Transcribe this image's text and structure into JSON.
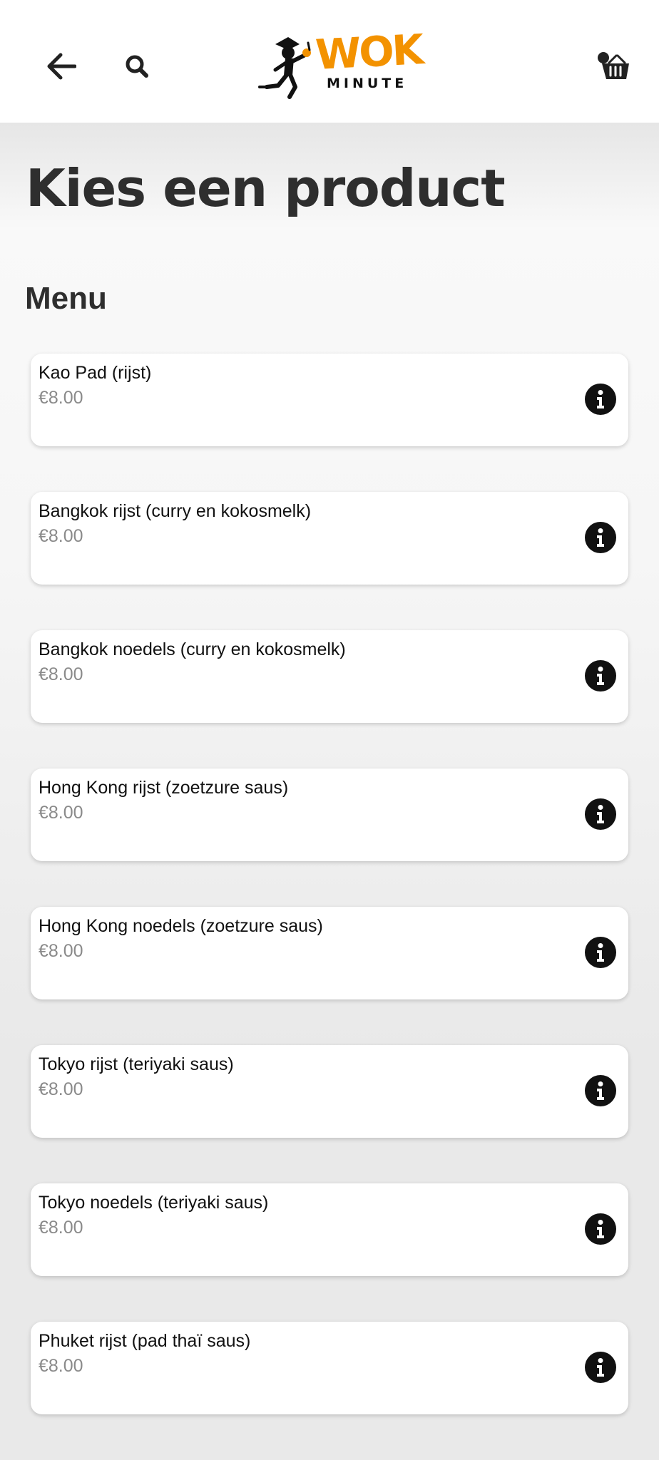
{
  "header": {
    "back_icon": "arrow-left-icon",
    "search_icon": "search-icon",
    "cart_icon": "basket-icon",
    "logo": {
      "line1": "WOK",
      "line2": "MINUTE",
      "brand_color": "#f39200"
    }
  },
  "page": {
    "title": "Kies een product"
  },
  "menu": {
    "section_title": "Menu",
    "items": [
      {
        "name": "Kao Pad (rijst)",
        "price": "€8.00"
      },
      {
        "name": "Bangkok rijst (curry en kokosmelk)",
        "price": "€8.00"
      },
      {
        "name": "Bangkok noedels (curry en kokosmelk)",
        "price": "€8.00"
      },
      {
        "name": "Hong Kong rijst (zoetzure saus)",
        "price": "€8.00"
      },
      {
        "name": "Hong Kong noedels (zoetzure saus)",
        "price": "€8.00"
      },
      {
        "name": "Tokyo rijst (teriyaki saus)",
        "price": "€8.00"
      },
      {
        "name": "Tokyo noedels (teriyaki saus)",
        "price": "€8.00"
      },
      {
        "name": "Phuket rijst (pad thaï saus)",
        "price": "€8.00"
      }
    ],
    "info_icon": "info-icon"
  }
}
